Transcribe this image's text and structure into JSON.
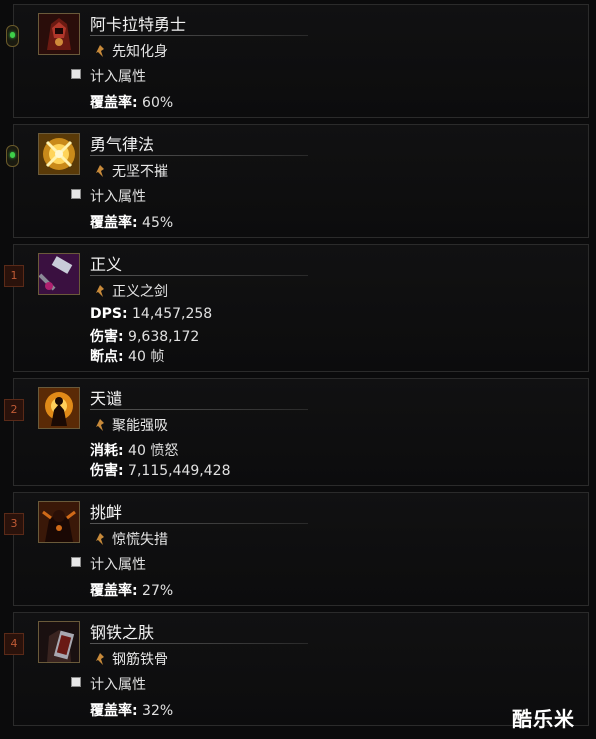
{
  "skills": [
    {
      "slot_type": "passive",
      "slot_label": "",
      "name": "阿卡拉特勇士",
      "rune": "先知化身",
      "checkbox_label": "计入属性",
      "stats": [
        {
          "label": "覆盖率:",
          "value": " 60%"
        }
      ]
    },
    {
      "slot_type": "passive",
      "slot_label": "",
      "name": "勇气律法",
      "rune": "无坚不摧",
      "checkbox_label": "计入属性",
      "stats": [
        {
          "label": "覆盖率:",
          "value": " 45%"
        }
      ]
    },
    {
      "slot_type": "slot",
      "slot_label": "1",
      "name": "正义",
      "rune": "正义之剑",
      "checkbox_label": "",
      "stats": [
        {
          "label": "DPS:",
          "value": " 14,457,258"
        },
        {
          "label": "伤害:",
          "value": " 9,638,172"
        },
        {
          "label": "断点:",
          "value": " 40 帧"
        }
      ]
    },
    {
      "slot_type": "slot",
      "slot_label": "2",
      "name": "天谴",
      "rune": "聚能强吸",
      "checkbox_label": "",
      "stats": [
        {
          "label": "消耗:",
          "value": " 40 愤怒"
        },
        {
          "label": "伤害:",
          "value": " 7,115,449,428"
        }
      ]
    },
    {
      "slot_type": "slot",
      "slot_label": "3",
      "name": "挑衅",
      "rune": "惊慌失措",
      "checkbox_label": "计入属性",
      "stats": [
        {
          "label": "覆盖率:",
          "value": " 27%"
        }
      ]
    },
    {
      "slot_type": "slot",
      "slot_label": "4",
      "name": "钢铁之肤",
      "rune": "钢筋铁骨",
      "checkbox_label": "计入属性",
      "stats": [
        {
          "label": "覆盖率:",
          "value": " 32%"
        }
      ]
    }
  ],
  "watermark": "酷乐米",
  "colors": {
    "passive_led": "#3ed04a",
    "slot_badge": "#c05a35",
    "panel_border": "#2b2b2b"
  }
}
